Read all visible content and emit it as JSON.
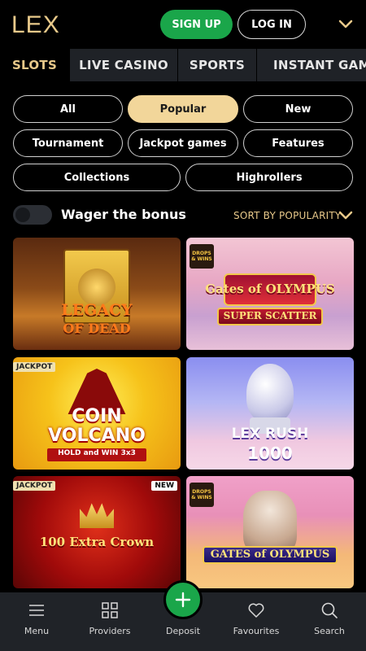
{
  "header": {
    "logo": "LEX",
    "signup_label": "SIGN UP",
    "login_label": "LOG IN"
  },
  "tabs": [
    {
      "label": "SLOTS",
      "active": true
    },
    {
      "label": "LIVE CASINO",
      "active": false
    },
    {
      "label": "SPORTS",
      "active": false
    },
    {
      "label": "INSTANT GAMES",
      "active": false
    }
  ],
  "filters": [
    {
      "label": "All",
      "active": false
    },
    {
      "label": "Popular",
      "active": true
    },
    {
      "label": "New",
      "active": false
    },
    {
      "label": "Tournament",
      "active": false
    },
    {
      "label": "Jackpot games",
      "active": false
    },
    {
      "label": "Features",
      "active": false
    },
    {
      "label": "Collections",
      "active": false
    },
    {
      "label": "Highrollers",
      "active": false
    }
  ],
  "wager": {
    "label": "Wager the bonus",
    "enabled": false
  },
  "sort": {
    "label": "SORT BY POPULARITY"
  },
  "games": [
    {
      "title_line1": "LEGACY",
      "title_line2": "OF DEAD",
      "badge": "",
      "drops": false
    },
    {
      "title_line1": "Gates of OLYMPUS",
      "title_line2": "SUPER SCATTER",
      "badge": "",
      "drops": true
    },
    {
      "title_line1": "COIN",
      "title_line2": "VOLCANO",
      "subtitle": "HOLD and WIN 3x3",
      "badge": "JACKPOT",
      "drops": false
    },
    {
      "title_line1": "LEX RUSH",
      "title_line2": "1000",
      "badge": "",
      "drops": false
    },
    {
      "title_line1": "100 Extra Crown",
      "title_line2": "",
      "badge": "JACKPOT",
      "badge_new": "NEW",
      "drops": false
    },
    {
      "title_line1": "GATES of OLYMPUS",
      "title_line2": "",
      "badge": "",
      "drops": true
    }
  ],
  "drops_text": "DROPS & WINS",
  "nav": {
    "menu": "Menu",
    "providers": "Providers",
    "deposit": "Deposit",
    "favourites": "Favourites",
    "search": "Search"
  },
  "colors": {
    "accent_gold": "#e8c98a",
    "signup_green": "#1aa64a",
    "chip_active": "#f2d69a",
    "nav_bg": "#202328"
  }
}
